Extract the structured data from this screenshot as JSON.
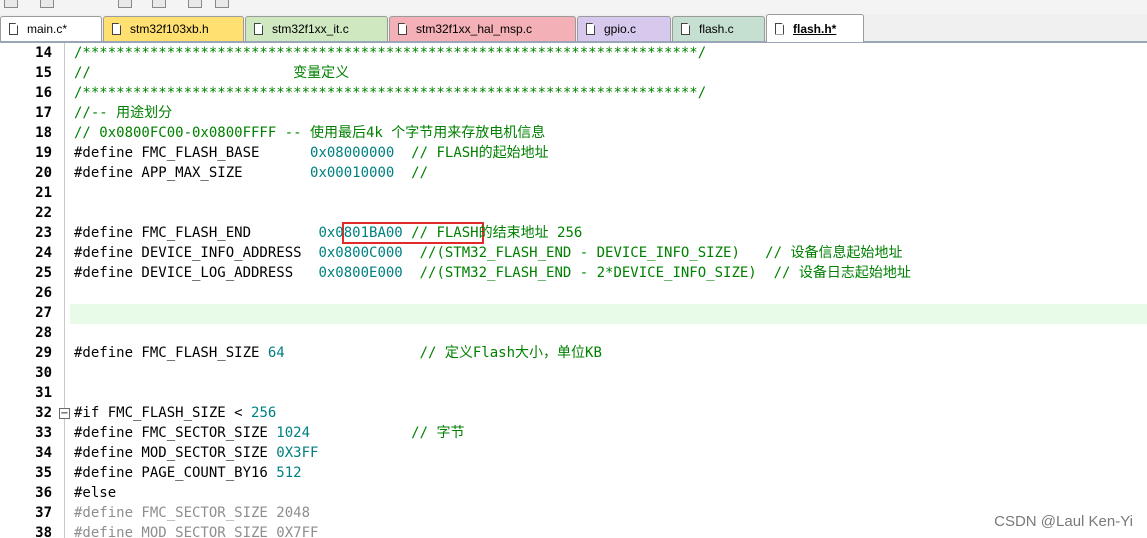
{
  "tabs": [
    {
      "label": "main.c*",
      "color": "#ffffff",
      "active": false
    },
    {
      "label": "stm32f103xb.h",
      "color": "#ffe070",
      "active": false
    },
    {
      "label": "stm32f1xx_it.c",
      "color": "#cfe8c0",
      "active": false
    },
    {
      "label": "stm32f1xx_hal_msp.c",
      "color": "#f3b0b6",
      "active": false
    },
    {
      "label": "gpio.c",
      "color": "#d7c9ee",
      "active": false
    },
    {
      "label": "flash.c",
      "color": "#c5dfd0",
      "active": false
    },
    {
      "label": "flash.h*",
      "color": "#ffffff",
      "active": true
    }
  ],
  "editor": {
    "lines": [
      {
        "n": "14",
        "code": "/*************************************************************************/",
        "type": "comment"
      },
      {
        "n": "15",
        "code": "//                        变量定义",
        "type": "comment"
      },
      {
        "n": "16",
        "code": "/*************************************************************************/",
        "type": "comment"
      },
      {
        "n": "17",
        "code": "//-- 用途划分",
        "type": "comment"
      },
      {
        "n": "18",
        "code": "// 0x0800FC00-0x0800FFFF -- 使用最后4k 个字节用来存放电机信息",
        "type": "comment"
      },
      {
        "n": "19",
        "pre": "#define FMC_FLASH_BASE      ",
        "val": "0x08000000",
        "post": "  // FLASH的起始地址"
      },
      {
        "n": "20",
        "pre": "#define APP_MAX_SIZE        ",
        "val": "0x00010000",
        "post": "  //"
      },
      {
        "n": "21",
        "code": ""
      },
      {
        "n": "22",
        "code": ""
      },
      {
        "n": "23",
        "pre": "#define FMC_FLASH_END        ",
        "val": "0x0801BA00",
        "post": " // FLASH的结束地址 256"
      },
      {
        "n": "24",
        "pre": "#define DEVICE_INFO_ADDRESS  ",
        "val": "0x0800C000",
        "post": "  //(STM32_FLASH_END - DEVICE_INFO_SIZE)   // 设备信息起始地址"
      },
      {
        "n": "25",
        "pre": "#define DEVICE_LOG_ADDRESS   ",
        "val": "0x0800E000",
        "post": "  //(STM32_FLASH_END - 2*DEVICE_INFO_SIZE)  // 设备日志起始地址"
      },
      {
        "n": "26",
        "code": ""
      },
      {
        "n": "27",
        "code": "",
        "highlight": true
      },
      {
        "n": "28",
        "code": ""
      },
      {
        "n": "29",
        "pre": "#define FMC_FLASH_SIZE ",
        "val": "64",
        "post": "                // 定义Flash大小，单位KB"
      },
      {
        "n": "30",
        "code": ""
      },
      {
        "n": "31",
        "code": ""
      },
      {
        "n": "32",
        "pre": "#if FMC_FLASH_SIZE < ",
        "val": "256",
        "post": "",
        "fold": true
      },
      {
        "n": "33",
        "pre": "#define FMC_SECTOR_SIZE ",
        "val": "1024",
        "post": "            // 字节"
      },
      {
        "n": "34",
        "pre": "#define MOD_SECTOR_SIZE ",
        "val": "0X3FF",
        "post": ""
      },
      {
        "n": "35",
        "pre": "#define PAGE_COUNT_BY16 ",
        "val": "512",
        "post": ""
      },
      {
        "n": "36",
        "code": "#else",
        "type": "plain"
      },
      {
        "n": "37",
        "code": "#define FMC_SECTOR_SIZE 2048",
        "type": "dim"
      },
      {
        "n": "38",
        "code": "#define MOD_SECTOR_SIZE 0X7FF",
        "type": "dim"
      }
    ]
  },
  "watermark": "CSDN @Laul Ken-Yi"
}
